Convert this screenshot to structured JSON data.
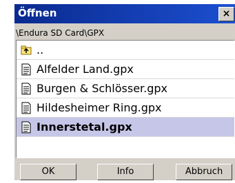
{
  "dialog": {
    "title": "Öffnen",
    "close_label": "×",
    "path": "\\Endura SD Card\\GPX"
  },
  "files": [
    {
      "label": "..",
      "icon": "folder-up-icon",
      "selected": false
    },
    {
      "label": "Alfelder Land.gpx",
      "icon": "file-icon",
      "selected": false
    },
    {
      "label": "Burgen & Schlösser.gpx",
      "icon": "file-icon",
      "selected": false
    },
    {
      "label": "Hildesheimer Ring.gpx",
      "icon": "file-icon",
      "selected": false
    },
    {
      "label": "Innerstetal.gpx",
      "icon": "file-icon",
      "selected": true
    }
  ],
  "buttons": {
    "ok_label": "OK",
    "info_label": "Info",
    "cancel_label": "Abbruch"
  },
  "colors": {
    "titlebar_start": "#0a2a8f",
    "titlebar_end": "#1c4fd0",
    "dialog_bg": "#d4d0c8",
    "selection": "#c6c6e8"
  }
}
